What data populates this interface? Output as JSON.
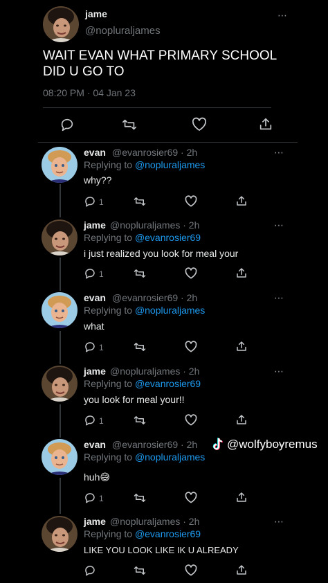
{
  "main_tweet": {
    "author_name": "jame",
    "author_handle": "@nopluraljames",
    "text_line1": "WAIT EVAN WHAT PRIMARY SCHOOL",
    "text_line2": "DID U GO TO",
    "timestamp": "08:20 PM · 04 Jan 23",
    "more_icon": "⋯"
  },
  "replies": [
    {
      "name": "evan",
      "handle": "@evanrosier69 · 2h",
      "replying_label": "Replying to",
      "replying_to": "@nopluraljames",
      "text": "why??",
      "reply_count": "1",
      "avatar": "evan"
    },
    {
      "name": "jame",
      "handle": "@nopluraljames · 2h",
      "replying_label": "Replying to",
      "replying_to": "@evanrosier69",
      "text": "i just realized you look for meal your",
      "reply_count": "1",
      "avatar": "jame"
    },
    {
      "name": "evan",
      "handle": "@evanrosier69 · 2h",
      "replying_label": "Replying to",
      "replying_to": "@nopluraljames",
      "text": "what",
      "reply_count": "1",
      "avatar": "evan"
    },
    {
      "name": "jame",
      "handle": "@nopluraljames · 2h",
      "replying_label": "Replying to",
      "replying_to": "@evanrosier69",
      "text": "you look for meal your!!",
      "reply_count": "1",
      "avatar": "jame"
    },
    {
      "name": "evan",
      "handle": "@evanrosier69 · 2h",
      "replying_label": "Replying to",
      "replying_to": "@nopluraljames",
      "text": "huh😅",
      "reply_count": "1",
      "avatar": "evan"
    },
    {
      "name": "jame",
      "handle": "@nopluraljames · 2h",
      "replying_label": "Replying to",
      "replying_to": "@evanrosier69",
      "text": "LIKE YOU LOOK LIKE IK U ALREADY",
      "reply_count": "",
      "avatar": "jame"
    }
  ],
  "watermark": {
    "text": "@wolfyboyremus",
    "icon": "tiktok-icon"
  },
  "colors": {
    "background": "#000000",
    "text": "#e7e9ea",
    "muted": "#71767b",
    "link": "#1d9bf0"
  }
}
